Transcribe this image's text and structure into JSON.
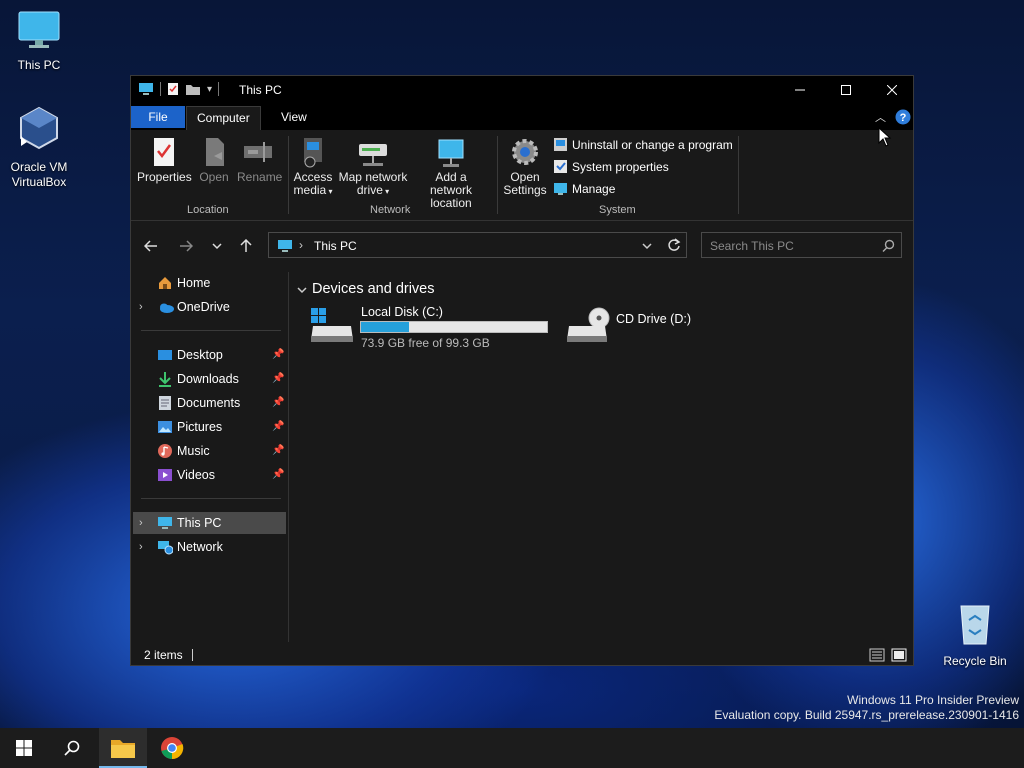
{
  "desktop": {
    "icons": [
      {
        "label": "This PC"
      },
      {
        "label": "Oracle VM VirtualBox"
      },
      {
        "label": "Recycle Bin"
      }
    ],
    "watermark": {
      "line1": "Windows 11 Pro Insider Preview",
      "line2": "Evaluation copy. Build 25947.rs_prerelease.230901-1416"
    }
  },
  "window": {
    "title": "This PC",
    "tabs": [
      {
        "label": "File"
      },
      {
        "label": "Computer",
        "active": true
      },
      {
        "label": "View"
      }
    ],
    "ribbon": {
      "groups": [
        {
          "label": "Location",
          "buttons": [
            {
              "label": "Properties",
              "enabled": true,
              "icon": "properties-icon"
            },
            {
              "label": "Open",
              "enabled": false,
              "icon": "open-icon"
            },
            {
              "label": "Rename",
              "enabled": false,
              "icon": "rename-icon"
            }
          ]
        },
        {
          "label": "Network",
          "buttons": [
            {
              "label_line1": "Access",
              "label_line2": "media",
              "icon": "access-media-icon"
            },
            {
              "label_line1": "Map network",
              "label_line2": "drive",
              "icon": "map-network-drive-icon"
            },
            {
              "label_line1": "Add a network",
              "label_line2": "location",
              "icon": "add-network-location-icon"
            }
          ]
        },
        {
          "label": "System",
          "buttons": [
            {
              "label_line1": "Open",
              "label_line2": "Settings",
              "icon": "settings-gear-icon"
            },
            {
              "label": "Uninstall or change a program",
              "icon": "uninstall-icon"
            },
            {
              "label": "System properties",
              "icon": "system-properties-icon"
            },
            {
              "label": "Manage",
              "icon": "manage-icon"
            }
          ]
        }
      ]
    },
    "address": {
      "path": "This PC",
      "search_placeholder": "Search This PC"
    },
    "nav_pane": {
      "top": [
        {
          "label": "Home",
          "icon": "home-icon"
        },
        {
          "label": "OneDrive",
          "icon": "onedrive-icon"
        }
      ],
      "quick_access": [
        {
          "label": "Desktop",
          "icon": "desktop-folder-icon",
          "pinned": true
        },
        {
          "label": "Downloads",
          "icon": "downloads-icon",
          "pinned": true
        },
        {
          "label": "Documents",
          "icon": "documents-icon",
          "pinned": true
        },
        {
          "label": "Pictures",
          "icon": "pictures-icon",
          "pinned": true
        },
        {
          "label": "Music",
          "icon": "music-icon",
          "pinned": true
        },
        {
          "label": "Videos",
          "icon": "videos-icon",
          "pinned": true
        }
      ],
      "bottom": [
        {
          "label": "This PC",
          "icon": "this-pc-icon",
          "selected": true
        },
        {
          "label": "Network",
          "icon": "network-icon"
        }
      ]
    },
    "content": {
      "section_title": "Devices and drives",
      "drives": [
        {
          "name": "Local Disk (C:)",
          "free_text": "73.9 GB free of 99.3 GB",
          "used_fraction": 0.256
        },
        {
          "name": "CD Drive (D:)"
        }
      ]
    },
    "status": {
      "items_text": "2 items"
    }
  },
  "colors": {
    "accent": "#1c63c9",
    "drive_bar": "#26a0da",
    "selected": "#4a4a4a"
  }
}
